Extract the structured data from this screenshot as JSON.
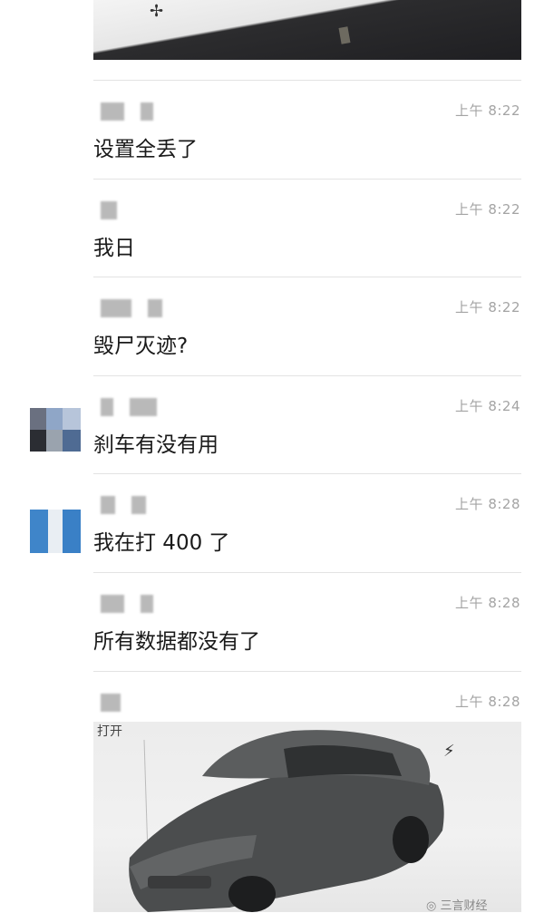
{
  "messages": [
    {
      "time": "上午 8:22",
      "text": "设置全丢了"
    },
    {
      "time": "上午 8:22",
      "text": "我日"
    },
    {
      "time": "上午 8:22",
      "text": "毁尸灭迹?"
    },
    {
      "time": "上午 8:24",
      "text": "刹车有没有用"
    },
    {
      "time": "上午 8:28",
      "text": "我在打 400 了"
    },
    {
      "time": "上午 8:28",
      "text": "所有数据都没有了"
    },
    {
      "time": "上午 8:28",
      "text": ""
    }
  ],
  "car_image": {
    "caption": "打开"
  },
  "watermark": {
    "text": "三言财经"
  },
  "icons": {
    "fan": "fan-icon",
    "charging": "charging-icon",
    "wechat": "wechat-icon"
  }
}
